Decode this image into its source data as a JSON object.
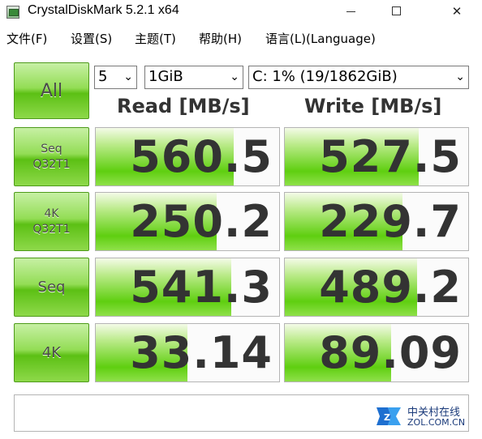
{
  "window": {
    "title": "CrystalDiskMark 5.2.1 x64",
    "minimize_glyph": "",
    "maximize_glyph": "",
    "close_glyph": "✕"
  },
  "menu": [
    {
      "label": "文件(F)"
    },
    {
      "label": "设置(S)"
    },
    {
      "label": "主题(T)"
    },
    {
      "label": "帮助(H)"
    },
    {
      "label": "语言(L)(Language)"
    }
  ],
  "controls": {
    "all_label": "All",
    "count_value": "5",
    "size_value": "1GiB",
    "drive_value": "C: 1% (19/1862GiB)",
    "read_header": "Read [MB/s]",
    "write_header": "Write [MB/s]"
  },
  "rows": [
    {
      "label": "Seq\nQ32T1",
      "read": "560.5",
      "write": "527.5",
      "read_fill": 0.75,
      "write_fill": 0.73
    },
    {
      "label": "4K\nQ32T1",
      "read": "250.2",
      "write": "229.7",
      "read_fill": 0.66,
      "write_fill": 0.64
    },
    {
      "label": "Seq",
      "read": "541.3",
      "write": "489.2",
      "read_fill": 0.74,
      "write_fill": 0.72
    },
    {
      "label": "4K",
      "read": "33.14",
      "write": "89.09",
      "read_fill": 0.5,
      "write_fill": 0.58
    }
  ],
  "status": {
    "text": ""
  },
  "watermark": {
    "cn": "中关村在线",
    "en": "ZOL.COM.CN"
  },
  "colors": {
    "accent_green": "#5cc014",
    "value_text": "#333333"
  }
}
